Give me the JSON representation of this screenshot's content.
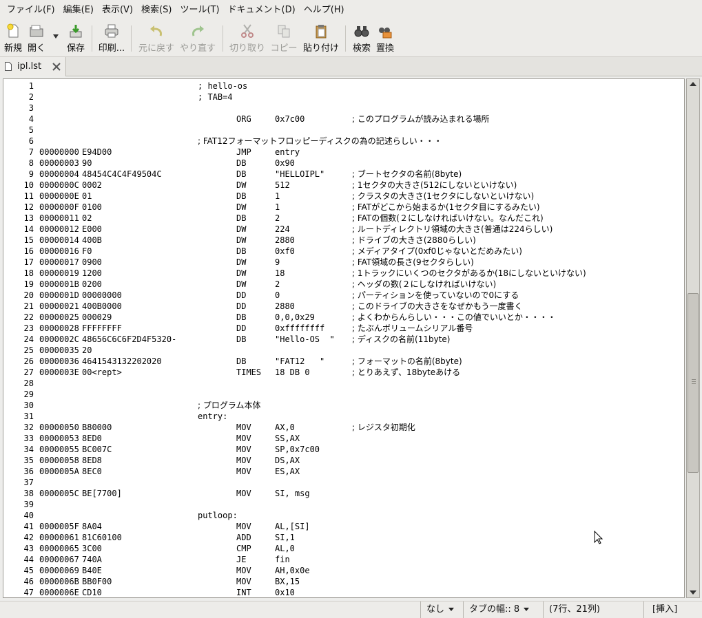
{
  "menu": [
    "ファイル(F)",
    "編集(E)",
    "表示(V)",
    "検索(S)",
    "ツール(T)",
    "ドキュメント(D)",
    "ヘルプ(H)"
  ],
  "toolbar": {
    "new": "新規",
    "open": "開く",
    "save": "保存",
    "print": "印刷...",
    "undo": "元に戻す",
    "redo": "やり直す",
    "cut": "切り取り",
    "copy": "コピー",
    "paste": "貼り付け",
    "find": "検索",
    "replace": "置換"
  },
  "tab": {
    "name": "ipl.lst"
  },
  "editor": {
    "lines": [
      {
        "n": "1",
        "addr": "",
        "hex": "",
        "label": "; hello-os",
        "op": "",
        "arg": "",
        "cmt": ""
      },
      {
        "n": "2",
        "addr": "",
        "hex": "",
        "label": "; TAB=4",
        "op": "",
        "arg": "",
        "cmt": ""
      },
      {
        "n": "3",
        "addr": "",
        "hex": "",
        "label": "",
        "op": "",
        "arg": "",
        "cmt": ""
      },
      {
        "n": "4",
        "addr": "",
        "hex": "",
        "label": "",
        "op": "ORG",
        "arg": "0x7c00",
        "cmt": "; このプログラムが読み込まれる場所"
      },
      {
        "n": "5",
        "addr": "",
        "hex": "",
        "label": "",
        "op": "",
        "arg": "",
        "cmt": ""
      },
      {
        "n": "6",
        "addr": "",
        "hex": "",
        "label": "; FAT12フォーマットフロッピーディスクの為の記述らしい・・・",
        "op": "",
        "arg": "",
        "cmt": ""
      },
      {
        "n": "7",
        "addr": "00000000",
        "hex": "E94D00",
        "label": "",
        "op": "JMP",
        "arg": "entry",
        "cmt": ""
      },
      {
        "n": "8",
        "addr": "00000003",
        "hex": "90",
        "label": "",
        "op": "DB",
        "arg": "0x90",
        "cmt": ""
      },
      {
        "n": "9",
        "addr": "00000004",
        "hex": "48454C4C4F49504C",
        "label": "",
        "op": "DB",
        "arg": "\"HELLOIPL\"",
        "cmt": "; ブートセクタの名前(8byte)"
      },
      {
        "n": "10",
        "addr": "0000000C",
        "hex": "0002",
        "label": "",
        "op": "DW",
        "arg": "512",
        "cmt": "; 1セクタの大きさ(512にしないといけない)"
      },
      {
        "n": "11",
        "addr": "0000000E",
        "hex": "01",
        "label": "",
        "op": "DB",
        "arg": "1",
        "cmt": "; クラスタの大きさ(1セクタにしないといけない)"
      },
      {
        "n": "12",
        "addr": "0000000F",
        "hex": "0100",
        "label": "",
        "op": "DW",
        "arg": "1",
        "cmt": "; FATがどこから始まるか(1セクタ目にするみたい)"
      },
      {
        "n": "13",
        "addr": "00000011",
        "hex": "02",
        "label": "",
        "op": "DB",
        "arg": "2",
        "cmt": "; FATの個数(２にしなければいけない。なんだこれ)"
      },
      {
        "n": "14",
        "addr": "00000012",
        "hex": "E000",
        "label": "",
        "op": "DW",
        "arg": "224",
        "cmt": "; ルートディレクトリ領域の大きさ(普通は224らしい)"
      },
      {
        "n": "15",
        "addr": "00000014",
        "hex": "400B",
        "label": "",
        "op": "DW",
        "arg": "2880",
        "cmt": "; ドライブの大きさ(2880らしい)"
      },
      {
        "n": "16",
        "addr": "00000016",
        "hex": "F0",
        "label": "",
        "op": "DB",
        "arg": "0xf0",
        "cmt": "; メディアタイプ(0xf0じゃないとだめみたい)"
      },
      {
        "n": "17",
        "addr": "00000017",
        "hex": "0900",
        "label": "",
        "op": "DW",
        "arg": "9",
        "cmt": "; FAT領域の長さ(9セクタらしい)"
      },
      {
        "n": "18",
        "addr": "00000019",
        "hex": "1200",
        "label": "",
        "op": "DW",
        "arg": "18",
        "cmt": "; 1トラックにいくつのセクタがあるか(18にしないといけない)"
      },
      {
        "n": "19",
        "addr": "0000001B",
        "hex": "0200",
        "label": "",
        "op": "DW",
        "arg": "2",
        "cmt": "; ヘッダの数(２にしなければいけない)"
      },
      {
        "n": "20",
        "addr": "0000001D",
        "hex": "00000000",
        "label": "",
        "op": "DD",
        "arg": "0",
        "cmt": "; パーティションを使っていないので0にする"
      },
      {
        "n": "21",
        "addr": "00000021",
        "hex": "400B0000",
        "label": "",
        "op": "DD",
        "arg": "2880",
        "cmt": "; このドライブの大きさをなぜかもう一度書く"
      },
      {
        "n": "22",
        "addr": "00000025",
        "hex": "000029",
        "label": "",
        "op": "DB",
        "arg": "0,0,0x29",
        "cmt": "; よくわからんらしい・・・この値でいいとか・・・・"
      },
      {
        "n": "23",
        "addr": "00000028",
        "hex": "FFFFFFFF",
        "label": "",
        "op": "DD",
        "arg": "0xffffffff",
        "cmt": "; たぶんボリュームシリアル番号"
      },
      {
        "n": "24",
        "addr": "0000002C",
        "hex": "48656C6C6F2D4F5320-",
        "label": "",
        "op": "DB",
        "arg": "\"Hello-OS  \"",
        "cmt": "; ディスクの名前(11byte)"
      },
      {
        "n": "25",
        "addr": "00000035",
        "hex": "20",
        "label": "",
        "op": "",
        "arg": "",
        "cmt": ""
      },
      {
        "n": "26",
        "addr": "00000036",
        "hex": "4641543132202020",
        "label": "",
        "op": "DB",
        "arg": "\"FAT12   \"",
        "cmt": "; フォーマットの名前(8byte)"
      },
      {
        "n": "27",
        "addr": "0000003E",
        "hex": "00<rept>",
        "label": "",
        "op": "TIMES",
        "arg": "18 DB 0",
        "cmt": "; とりあえず、18byteあける"
      },
      {
        "n": "28",
        "addr": "",
        "hex": "",
        "label": "",
        "op": "",
        "arg": "",
        "cmt": ""
      },
      {
        "n": "29",
        "addr": "",
        "hex": "",
        "label": "",
        "op": "",
        "arg": "",
        "cmt": ""
      },
      {
        "n": "30",
        "addr": "",
        "hex": "",
        "label": "; プログラム本体",
        "op": "",
        "arg": "",
        "cmt": ""
      },
      {
        "n": "31",
        "addr": "",
        "hex": "",
        "label": "entry:",
        "op": "",
        "arg": "",
        "cmt": ""
      },
      {
        "n": "32",
        "addr": "00000050",
        "hex": "B80000",
        "label": "",
        "op": "MOV",
        "arg": "AX,0",
        "cmt": "; レジスタ初期化"
      },
      {
        "n": "33",
        "addr": "00000053",
        "hex": "8ED0",
        "label": "",
        "op": "MOV",
        "arg": "SS,AX",
        "cmt": ""
      },
      {
        "n": "34",
        "addr": "00000055",
        "hex": "BC007C",
        "label": "",
        "op": "MOV",
        "arg": "SP,0x7c00",
        "cmt": ""
      },
      {
        "n": "35",
        "addr": "00000058",
        "hex": "8ED8",
        "label": "",
        "op": "MOV",
        "arg": "DS,AX",
        "cmt": ""
      },
      {
        "n": "36",
        "addr": "0000005A",
        "hex": "8EC0",
        "label": "",
        "op": "MOV",
        "arg": "ES,AX",
        "cmt": ""
      },
      {
        "n": "37",
        "addr": "",
        "hex": "",
        "label": "",
        "op": "",
        "arg": "",
        "cmt": ""
      },
      {
        "n": "38",
        "addr": "0000005C",
        "hex": "BE[7700]",
        "label": "",
        "op": "MOV",
        "arg": "SI, msg",
        "cmt": ""
      },
      {
        "n": "39",
        "addr": "",
        "hex": "",
        "label": "",
        "op": "",
        "arg": "",
        "cmt": ""
      },
      {
        "n": "40",
        "addr": "",
        "hex": "",
        "label": "putloop:",
        "op": "",
        "arg": "",
        "cmt": ""
      },
      {
        "n": "41",
        "addr": "0000005F",
        "hex": "8A04",
        "label": "",
        "op": "MOV",
        "arg": "AL,[SI]",
        "cmt": ""
      },
      {
        "n": "42",
        "addr": "00000061",
        "hex": "81C60100",
        "label": "",
        "op": "ADD",
        "arg": "SI,1",
        "cmt": ""
      },
      {
        "n": "43",
        "addr": "00000065",
        "hex": "3C00",
        "label": "",
        "op": "CMP",
        "arg": "AL,0",
        "cmt": ""
      },
      {
        "n": "44",
        "addr": "00000067",
        "hex": "740A",
        "label": "",
        "op": "JE",
        "arg": "fin",
        "cmt": ""
      },
      {
        "n": "45",
        "addr": "00000069",
        "hex": "B40E",
        "label": "",
        "op": "MOV",
        "arg": "AH,0x0e",
        "cmt": ""
      },
      {
        "n": "46",
        "addr": "0000006B",
        "hex": "BB0F00",
        "label": "",
        "op": "MOV",
        "arg": "BX,15",
        "cmt": ""
      },
      {
        "n": "47",
        "addr": "0000006E",
        "hex": "CD10",
        "label": "",
        "op": "INT",
        "arg": "0x10",
        "cmt": ""
      }
    ]
  },
  "scrollbar": {
    "position": 0.64,
    "visible_fraction": 0.36
  },
  "status": {
    "highlight": "なし",
    "tab_width": "タブの幅:: 8",
    "position": "(7行、21列)",
    "mode": "[挿入]"
  }
}
